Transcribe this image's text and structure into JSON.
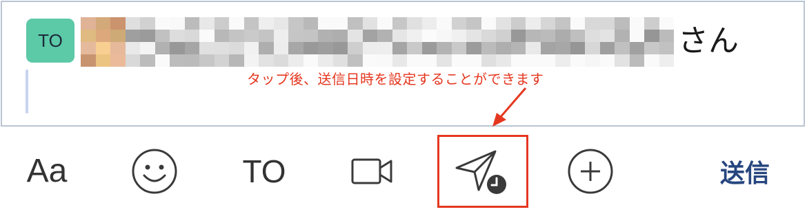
{
  "compose": {
    "to_chip_label": "TO",
    "recipient_suffix": "さん",
    "recipient_name_redacted": true
  },
  "annotation": {
    "text": "タップ後、送信日時を設定することができます",
    "color": "#e5371f"
  },
  "toolbar": {
    "font_label": "Aa",
    "emoji_icon": "smiley-icon",
    "to_label": "TO",
    "video_icon": "video-camera-icon",
    "schedule_icon": "scheduled-send-icon",
    "add_icon": "plus-circle-icon",
    "send_label": "送信"
  },
  "colors": {
    "to_chip": "#5cc9a7",
    "send_label": "#27467f",
    "highlight": "#e5371f",
    "compose_border": "#b9c4d2"
  }
}
